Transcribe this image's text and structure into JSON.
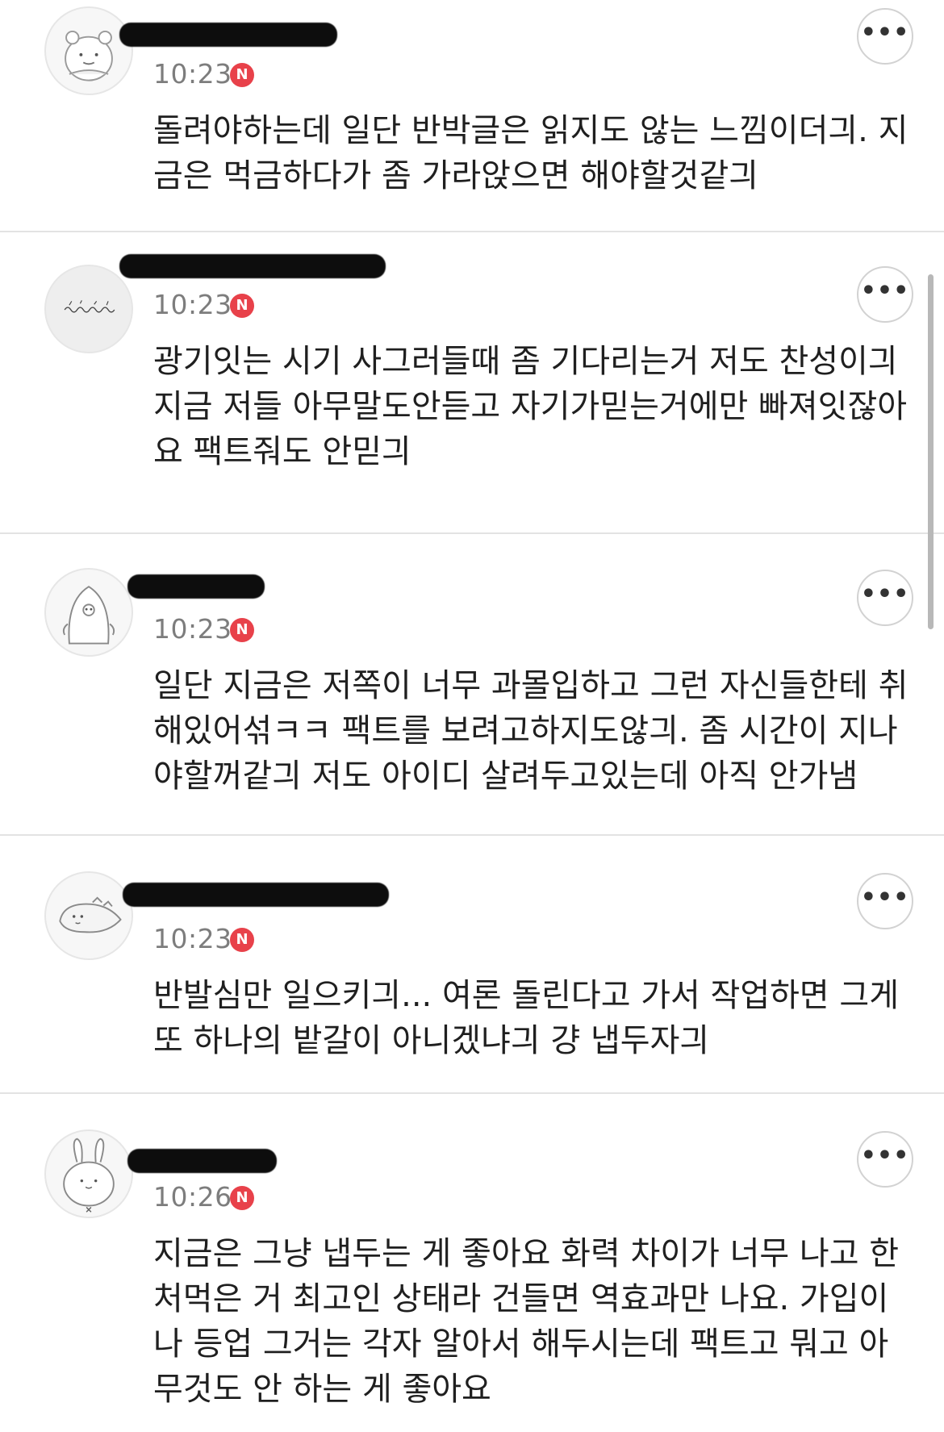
{
  "comments": [
    {
      "time": "10:23",
      "new_badge": "N",
      "more_label": "•••",
      "text": "돌려야하는데 일단 반박글은 읽지도 않는 느낌이더긔. 지금은 먹금하다가 좀 가라앉으면 해야할것같긔",
      "avatar_icon": "hamster-icon"
    },
    {
      "time": "10:23",
      "new_badge": "N",
      "more_label": "•••",
      "text": "광기잇는 시기 사그러들때 좀 기다리는거 저도 찬성이긔 지금 저들 아무말도안듣고 자기가믿는거에만 빠져잇잖아요 팩트줘도 안믿긔",
      "avatar_icon": "handwriting-avatar-icon"
    },
    {
      "time": "10:23",
      "new_badge": "N",
      "more_label": "•••",
      "text": "일단 지금은 저쪽이 너무 과몰입하고 그런 자신들한테 취해있어섞ㅋㅋ 팩트를 보려고하지도않긔. 좀 시간이 지나야할꺼같긔 저도 아이디 살려두고있는데 아직 안가냄",
      "avatar_icon": "penguin-icon"
    },
    {
      "time": "10:23",
      "new_badge": "N",
      "more_label": "•••",
      "text": "반발심만 일으키긔... 여론 돌린다고 가서 작업하면 그게 또 하나의 밭갈이 아니겠냐긔 걍 냅두자긔",
      "avatar_icon": "seal-icon"
    },
    {
      "time": "10:26",
      "new_badge": "N",
      "more_label": "•••",
      "text": "지금은 그냥 냅두는 게 좋아요 화력 차이가 너무 나고 한 처먹은 거 최고인 상태라 건들면 역효과만 나요. 가입이나 등업 그거는 각자 알아서 해두시는데 팩트고 뭐고 아무것도 안 하는 게 좋아요",
      "avatar_icon": "rabbit-icon"
    }
  ]
}
